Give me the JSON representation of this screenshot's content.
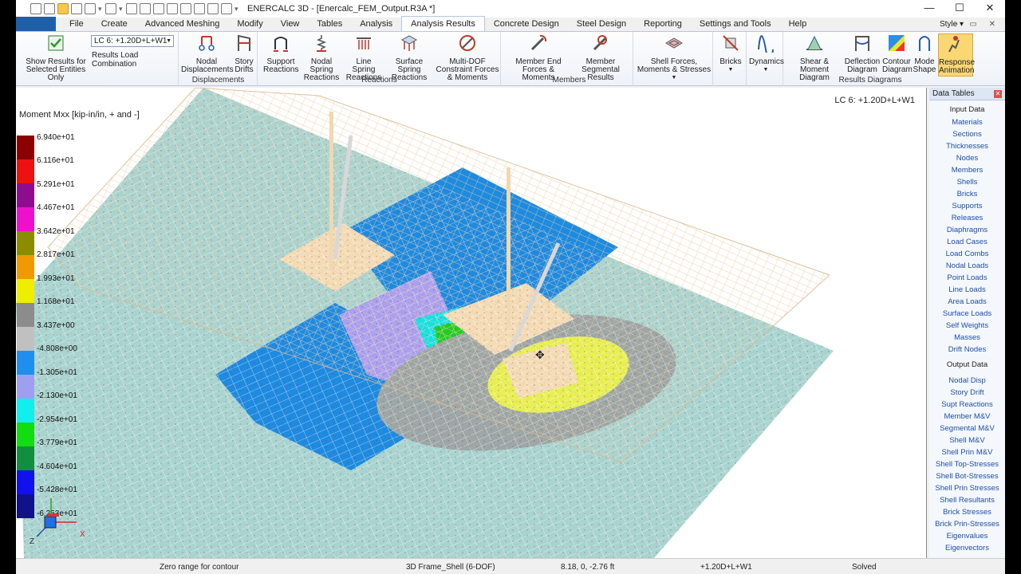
{
  "window": {
    "title": "ENERCALC 3D - [Enercalc_FEM_Output.R3A *]",
    "min": "—",
    "max": "☐",
    "close": "✕"
  },
  "tabs": [
    {
      "label": "File",
      "active": false
    },
    {
      "label": "Create",
      "active": false
    },
    {
      "label": "Advanced Meshing",
      "active": false
    },
    {
      "label": "Modify",
      "active": false
    },
    {
      "label": "View",
      "active": false
    },
    {
      "label": "Tables",
      "active": false
    },
    {
      "label": "Analysis",
      "active": false
    },
    {
      "label": "Analysis Results",
      "active": true
    },
    {
      "label": "Concrete Design",
      "active": false
    },
    {
      "label": "Steel Design",
      "active": false
    },
    {
      "label": "Reporting",
      "active": false
    },
    {
      "label": "Settings and Tools",
      "active": false
    },
    {
      "label": "Help",
      "active": false
    }
  ],
  "style_label": "Style",
  "ribbon": {
    "show_results": "Show Results for Selected Entities Only",
    "load_combo": "LC 6:  +1.20D+L+W1",
    "load_combo_label": "Results Load Combination",
    "groups": {
      "displacements": "Displacements",
      "reactions": "Reactions",
      "members": "Members",
      "results_diagrams": "Results Diagrams"
    },
    "buttons": {
      "nodal_disp": "Nodal Displacements",
      "story_drifts": "Story Drifts",
      "support_reactions": "Support Reactions",
      "nodal_spring": "Nodal Spring Reactions",
      "line_spring": "Line Spring Reactions",
      "surface_spring": "Surface Spring Reactions",
      "multi_dof": "Multi-DOF Constraint Forces & Moments",
      "member_end": "Member End Forces & Moments",
      "member_seg": "Member Segmental Results",
      "shell_forces": "Shell Forces, Moments & Stresses",
      "bricks": "Bricks",
      "dynamics": "Dynamics",
      "shear_moment": "Shear & Moment Diagram",
      "deflection": "Deflection Diagram",
      "contour": "Contour Diagram",
      "mode_shape": "Mode Shape",
      "response_anim": "Response Animation"
    }
  },
  "viewport": {
    "legend_title": "Moment Mxx [kip-in/in, + and -]",
    "load_case": "LC 6:  +1.20D+L+W1",
    "legend": [
      {
        "value": "6.940e+01",
        "color": "#8b0000"
      },
      {
        "value": "6.116e+01",
        "color": "#ee1111"
      },
      {
        "value": "5.291e+01",
        "color": "#8e0d8e"
      },
      {
        "value": "4.467e+01",
        "color": "#ee11cc"
      },
      {
        "value": "3.642e+01",
        "color": "#8c8c00"
      },
      {
        "value": "2.817e+01",
        "color": "#ef9a00"
      },
      {
        "value": "1.993e+01",
        "color": "#eeee00"
      },
      {
        "value": "1.168e+01",
        "color": "#8c8c8c"
      },
      {
        "value": "3.437e+00",
        "color": "#c0c0c0"
      },
      {
        "value": "-4.808e+00",
        "color": "#1f8fef"
      },
      {
        "value": "-1.305e+01",
        "color": "#9f9ff0"
      },
      {
        "value": "-2.130e+01",
        "color": "#11eeee"
      },
      {
        "value": "-2.954e+01",
        "color": "#11dd11"
      },
      {
        "value": "-3.779e+01",
        "color": "#118f3e"
      },
      {
        "value": "-4.604e+01",
        "color": "#1111ee"
      },
      {
        "value": "-5.428e+01",
        "color": "#11118a"
      },
      {
        "value": "-6.253e+01",
        "color": "#11118a"
      }
    ],
    "axes": {
      "x": "X",
      "z": "Z"
    }
  },
  "data_tables": {
    "title": "Data Tables",
    "input_header": "Input Data",
    "input": [
      "Materials",
      "Sections",
      "Thicknesses",
      "Nodes",
      "Members",
      "Shells",
      "Bricks",
      "Supports",
      "Releases",
      "Diaphragms",
      "Load Cases",
      "Load Combs",
      "Nodal Loads",
      "Point Loads",
      "Line Loads",
      "Area Loads",
      "Surface Loads",
      "Self Weights",
      "Masses",
      "Drift Nodes"
    ],
    "output_header": "Output Data",
    "output": [
      "Nodal Disp",
      "Story Drift",
      "Supt Reactions",
      "Member M&V",
      "Segmental M&V",
      "Shell M&V",
      "Shell Prin M&V",
      "Shell Top-Stresses",
      "Shell Bot-Stresses",
      "Shell Prin Stresses",
      "Shell Resultants",
      "Brick Stresses",
      "Brick Prin-Stresses",
      "Eigenvalues",
      "Eigenvectors"
    ]
  },
  "status": {
    "message": "Zero range for contour",
    "frame": "3D Frame_Shell (6-DOF)",
    "coords": "8.18, 0, -2.76 ft",
    "combo": "+1.20D+L+W1",
    "state": "Solved"
  }
}
